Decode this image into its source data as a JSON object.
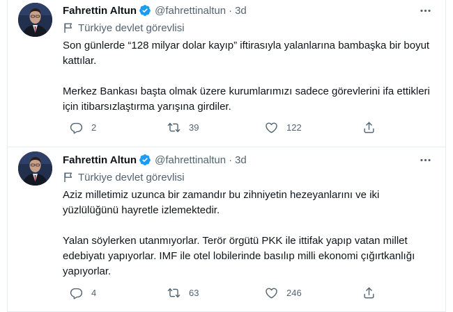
{
  "tweets": [
    {
      "author_name": "Fahrettin Altun",
      "handle": "@fahrettinaltun",
      "separator": "·",
      "time": "3d",
      "account_label": "Türkiye devlet görevlisi",
      "paragraphs": [
        "Son günlerde “128 milyar dolar kayıp” iftirasıyla yalanlarına bambaşka bir boyut kattılar.",
        "Merkez Bankası başta olmak üzere kurumlarımızı sadece görevlerini ifa ettikleri için itibarsızlaştırma yarışına girdiler."
      ],
      "replies": "2",
      "retweets": "39",
      "likes": "122"
    },
    {
      "author_name": "Fahrettin Altun",
      "handle": "@fahrettinaltun",
      "separator": "·",
      "time": "3d",
      "account_label": "Türkiye devlet görevlisi",
      "paragraphs": [
        "Aziz milletimiz uzunca bir zamandır bu zihniyetin hezeyanlarını ve iki yüzlülüğünü hayretle izlemektedir.",
        "Yalan söylerken utanmıyorlar. Terör örgütü PKK ile ittifak yapıp vatan millet edebiyatı yapıyorlar. IMF ile otel lobilerinde basılıp milli ekonomi çığırtkanlığı yapıyorlar."
      ],
      "replies": "4",
      "retweets": "63",
      "likes": "246"
    }
  ],
  "colors": {
    "text": "#0f1419",
    "secondary": "#536471",
    "verified": "#1d9bf0",
    "divider": "#e6ecf0"
  },
  "icons": [
    "verified-badge-icon",
    "more-options-icon",
    "government-flag-icon",
    "reply-icon",
    "retweet-icon",
    "like-icon",
    "share-icon"
  ]
}
